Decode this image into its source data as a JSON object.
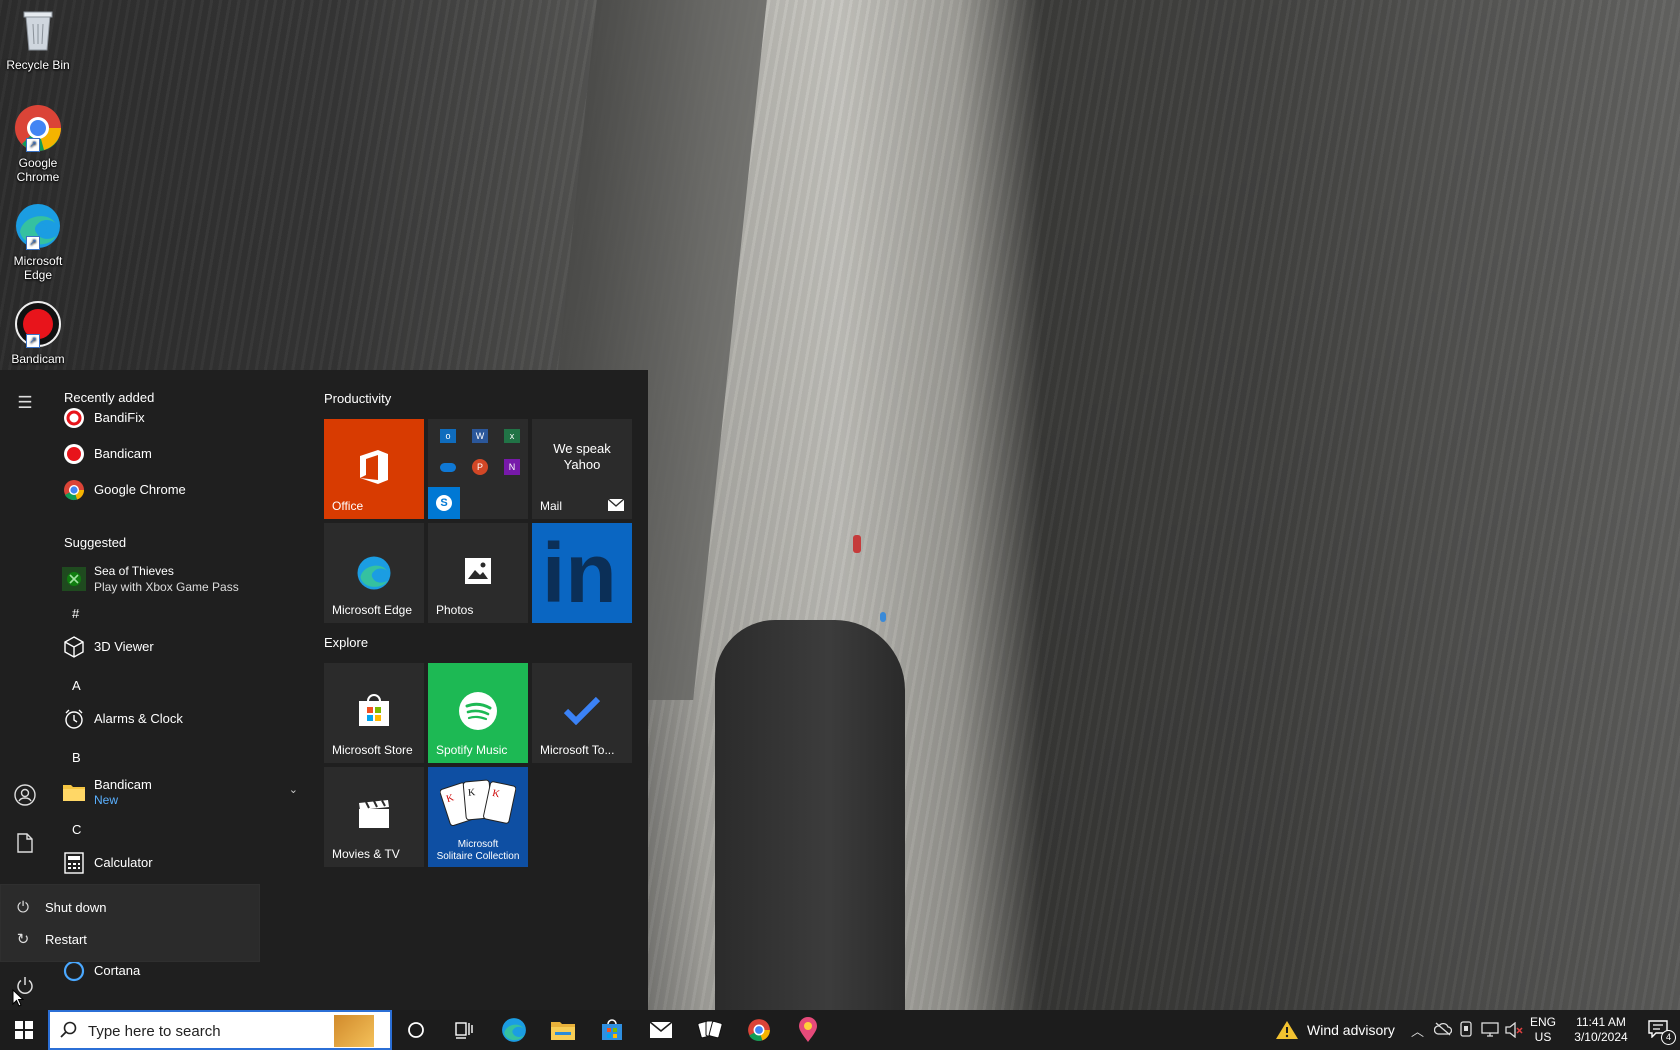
{
  "desktop": {
    "icons": [
      {
        "label": "Recycle Bin"
      },
      {
        "label": "Google Chrome"
      },
      {
        "label": "Microsoft Edge"
      },
      {
        "label": "Bandicam"
      }
    ]
  },
  "start_menu": {
    "recently_added_heading": "Recently added",
    "recent_apps": [
      "BandiFix",
      "Bandicam",
      "Google Chrome"
    ],
    "suggested_heading": "Suggested",
    "suggested_app": {
      "title": "Sea of Thieves",
      "subtitle": "Play with Xbox Game Pass"
    },
    "letters": [
      "#",
      "A",
      "B",
      "C"
    ],
    "apps": {
      "viewer3d": "3D Viewer",
      "alarms": "Alarms & Clock",
      "bandicam_folder": "Bandicam",
      "bandicam_new": "New",
      "calculator": "Calculator",
      "cortana": "Cortana"
    },
    "power_menu": {
      "shut_down": "Shut down",
      "restart": "Restart"
    },
    "groups": {
      "productivity": "Productivity",
      "explore": "Explore"
    },
    "tiles": {
      "office": "Office",
      "mail_promo_line1": "We speak",
      "mail_promo_line2": "Yahoo",
      "mail": "Mail",
      "edge": "Microsoft Edge",
      "photos": "Photos",
      "linkedin": "in",
      "store": "Microsoft Store",
      "spotify": "Spotify Music",
      "todo": "Microsoft To...",
      "movies": "Movies & TV",
      "solitaire_line1": "Microsoft",
      "solitaire_line2": "Solitaire Collection"
    }
  },
  "taskbar": {
    "search_placeholder": "Type here to search",
    "weather": "Wind advisory",
    "lang_top": "ENG",
    "lang_bottom": "US",
    "time": "11:41 AM",
    "date": "3/10/2024",
    "notification_count": "4"
  },
  "colors": {
    "office_tile": "#d83b01",
    "linkedin_tile": "#0a66c2",
    "spotify_tile": "#1db954",
    "solitaire_tile": "#0e4fa3",
    "accent": "#2b6fd6"
  }
}
